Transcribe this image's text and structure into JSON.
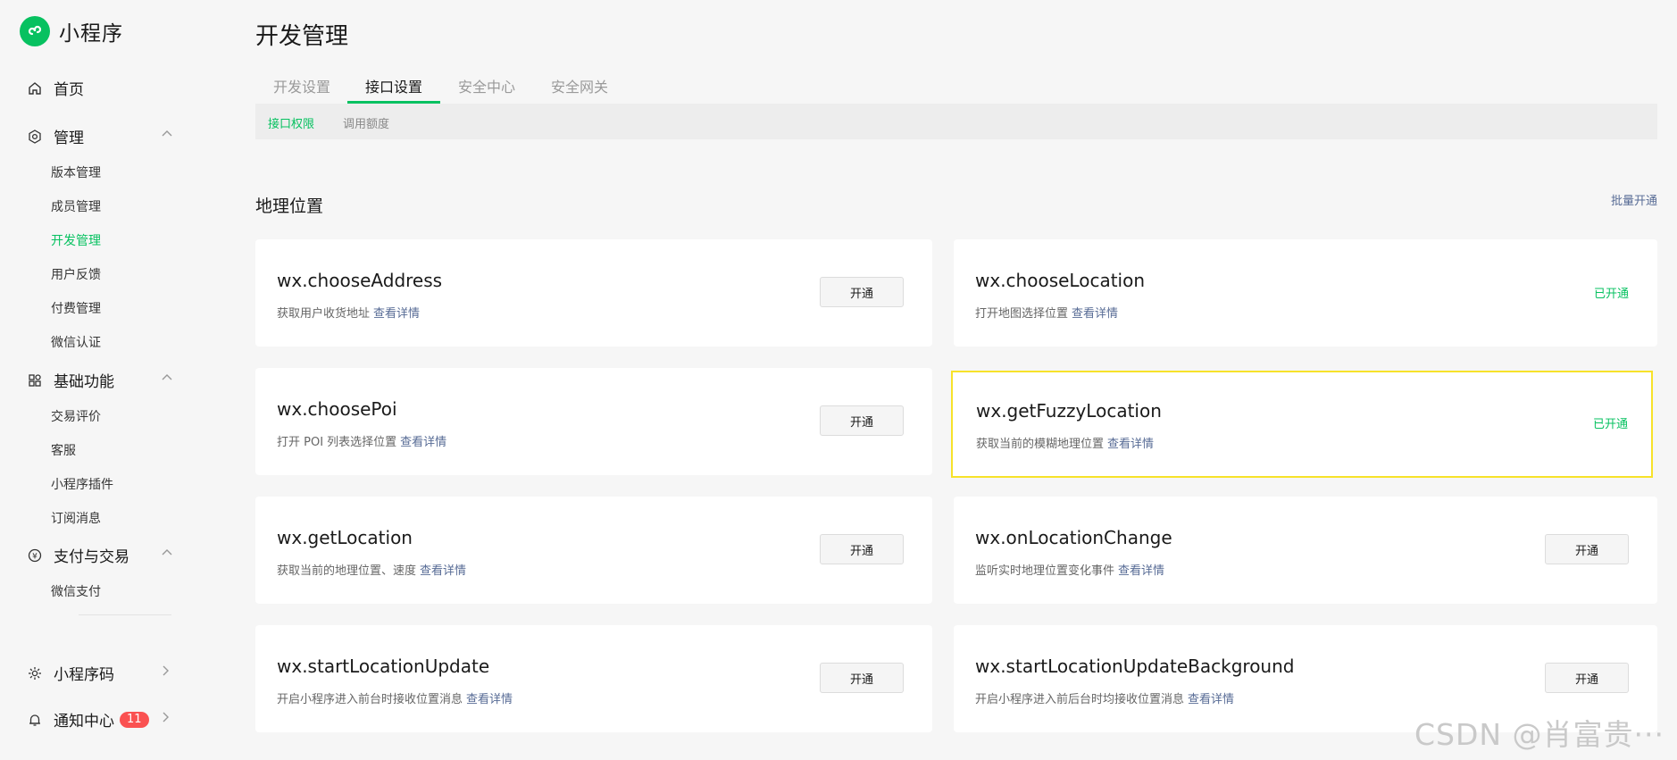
{
  "app": {
    "name": "小程序",
    "brand_color": "#07c160"
  },
  "sidebar": {
    "home": {
      "label": "首页",
      "icon": "home-icon"
    },
    "groups": [
      {
        "label": "管理",
        "icon": "settings-icon",
        "items": [
          "版本管理",
          "成员管理",
          "开发管理",
          "用户反馈",
          "付费管理",
          "微信认证"
        ],
        "active": "开发管理"
      },
      {
        "label": "基础功能",
        "icon": "grid-icon",
        "items": [
          "交易评价",
          "客服",
          "小程序插件",
          "订阅消息"
        ]
      },
      {
        "label": "支付与交易",
        "icon": "yen-icon",
        "items": [
          "微信支付"
        ]
      }
    ],
    "bottom": [
      {
        "label": "小程序码",
        "icon": "sun-icon"
      },
      {
        "label": "通知中心",
        "icon": "bell-icon",
        "badge": "11"
      }
    ]
  },
  "page": {
    "title": "开发管理"
  },
  "tabs": [
    "开发设置",
    "接口设置",
    "安全中心",
    "安全网关"
  ],
  "active_tab": "接口设置",
  "subtabs": [
    "接口权限",
    "调用额度"
  ],
  "active_subtab": "接口权限",
  "section": {
    "title": "地理位置",
    "batch_label": "批量开通"
  },
  "cards": [
    {
      "name": "wx.chooseAddress",
      "desc": "获取用户收货地址",
      "link": "查看详情",
      "action": "开通"
    },
    {
      "name": "wx.chooseLocation",
      "desc": "打开地图选择位置",
      "link": "查看详情",
      "status": "已开通"
    },
    {
      "name": "wx.choosePoi",
      "desc": "打开 POI 列表选择位置",
      "link": "查看详情",
      "action": "开通"
    },
    {
      "name": "wx.getFuzzyLocation",
      "desc": "获取当前的模糊地理位置",
      "link": "查看详情",
      "status": "已开通"
    },
    {
      "name": "wx.getLocation",
      "desc": "获取当前的地理位置、速度",
      "link": "查看详情",
      "action": "开通"
    },
    {
      "name": "wx.onLocationChange",
      "desc": "监听实时地理位置变化事件",
      "link": "查看详情",
      "action": "开通"
    },
    {
      "name": "wx.startLocationUpdate",
      "desc": "开启小程序进入前台时接收位置消息",
      "link": "查看详情",
      "action": "开通"
    },
    {
      "name": "wx.startLocationUpdateBackground",
      "desc": "开启小程序进入前后台时均接收位置消息",
      "link": "查看详情",
      "action": "开通"
    }
  ],
  "watermark": "CSDN @肖富贵···"
}
